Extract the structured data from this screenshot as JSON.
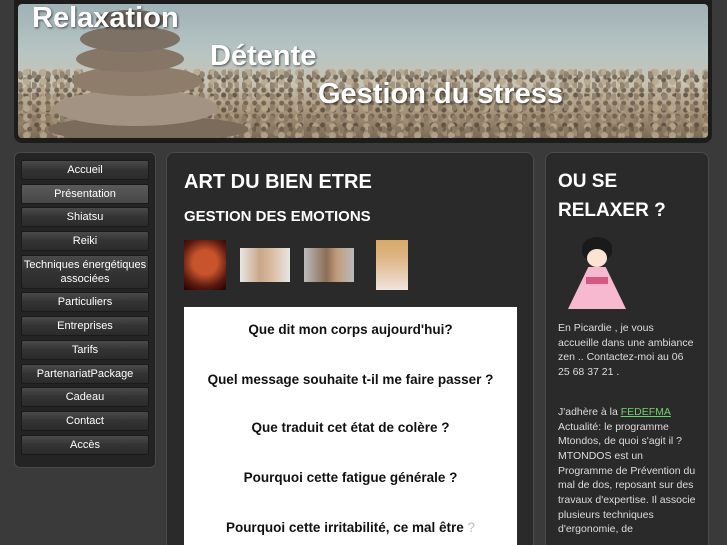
{
  "header": {
    "title_1": "Relaxation",
    "title_2": "Détente",
    "title_3": "Gestion du stress"
  },
  "nav": {
    "items": [
      {
        "label": "Accueil"
      },
      {
        "label": "Présentation"
      },
      {
        "label": "Shiatsu"
      },
      {
        "label": "Reiki"
      },
      {
        "label": "Techniques énergétiques associées"
      },
      {
        "label": "Particuliers"
      },
      {
        "label": "Entreprises"
      },
      {
        "label": "Tarifs"
      },
      {
        "label": "PartenariatPackage"
      },
      {
        "label": "Cadeau"
      },
      {
        "label": "Contact"
      },
      {
        "label": "Accès"
      }
    ]
  },
  "main": {
    "title": "ART DU BIEN ETRE",
    "subtitle": "GESTION DES EMOTIONS",
    "questions": [
      "Que dit  mon corps aujourd'hui?",
      "Quel message souhaite t-il me faire passer ?",
      "Que traduit cet état de colère ?",
      "Pourquoi cette fatigue générale ?",
      "Pourquoi cette irritabilité, ce mal être"
    ],
    "q5_mark": "?"
  },
  "side": {
    "title_line1": "OU SE",
    "title_line2": "RELAXER ?",
    "intro": "En Picardie , je vous accueille dans une ambiance zen .. Contactez-moi au 06 25 68 37 21 .",
    "adhere_prefix": "J'adhère à la ",
    "adhere_link": "FEDEFMA",
    "adhere_text": "Actualité: le programme Mtondos, de quoi s'agit il ? MTONDOS est un Programme de Prévention du mal de dos, reposant sur des travaux d'expertise. Il associe plusieurs techniques d'ergonomie, de"
  },
  "colors": {
    "background": "#3a3a3a",
    "panel": "#2a2a2a",
    "link": "#6fd06f"
  }
}
